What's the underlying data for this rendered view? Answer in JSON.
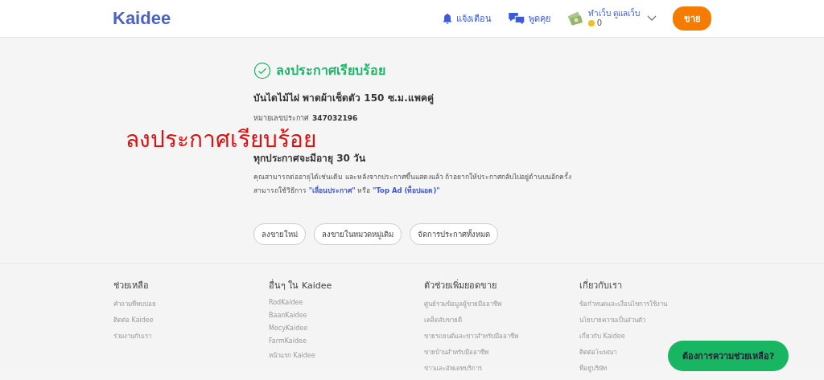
{
  "header": {
    "logo": "Kaidee",
    "nav": [
      {
        "kind": "bell",
        "label": "แจ้งเตือน"
      },
      {
        "kind": "chat",
        "label": "พูดคุย"
      }
    ],
    "user": {
      "name": "ทำเว็บ ดูแลเว็บ",
      "coins": "0"
    },
    "sell_button": "ขาย"
  },
  "success": {
    "title": "ลงประกาศเรียบร้อย",
    "item_title": "บันไดไม้ไผ่ พาดผ้าเช็ดตัว 150 ซ.ม.แพคคู่",
    "ad_number_label": "หมายเลขประกาศ",
    "ad_number": "347032196",
    "lifetime_heading": "ทุกประกาศจะมีอายุ 30 วัน",
    "note": "คุณสามารถต่ออายุได้เช่นเดิม และหลังจากประกาศขึ้นแสดงแล้ว ถ้าอยากให้ประกาศกลับไปอยู่ด้านบนอีกครั้ง สามารถใช้วิธีการ",
    "link_1": "\"เลื่อนประกาศ\"",
    "or": "หรือ",
    "link_2": "\"Top Ad (ท็อปแอด)\"",
    "buttons": [
      "ลงขายใหม่",
      "ลงขายในหมวดหมู่เดิม",
      "จัดการประกาศทั้งหมด"
    ]
  },
  "overlay_caption": "ลงประกาศเรียบร้อย",
  "footer": {
    "columns": [
      {
        "heading": "ช่วยเหลือ",
        "links": [
          "คำถามที่พบบ่อย",
          "ติดต่อ Kaidee",
          "ร่วมงานกับเรา"
        ]
      },
      {
        "heading": "อื่นๆ ใน Kaidee",
        "links": [
          "RodKaidee",
          "BaanKaidee",
          "MocyKaidee",
          "FarmKaidee",
          "หน้าแรก Kaidee"
        ]
      },
      {
        "heading": "ตัวช่วยเพิ่มยอดขาย",
        "links": [
          "ศูนย์รวมข้อมูลผู้ขายมืออาชีพ",
          "เคล็ดลับขายดี",
          "ขายรถยนต์และข่าวสำหรับมืออาชีพ",
          "ขายบ้านสำหรับมืออาชีพ",
          "ข่าวและอัพเดทบริการ"
        ]
      },
      {
        "heading": "เกี่ยวกับเรา",
        "links": [
          "ข้อกำหนดและเงื่อนไขการใช้งาน",
          "นโยบายความเป็นส่วนตัว",
          "เกี่ยวกับ Kaidee",
          "ติดต่อโฆษณา",
          "ที่อยู่บริษัท"
        ]
      }
    ]
  },
  "help_button": "ต้องการความช่วยเหลือ?"
}
